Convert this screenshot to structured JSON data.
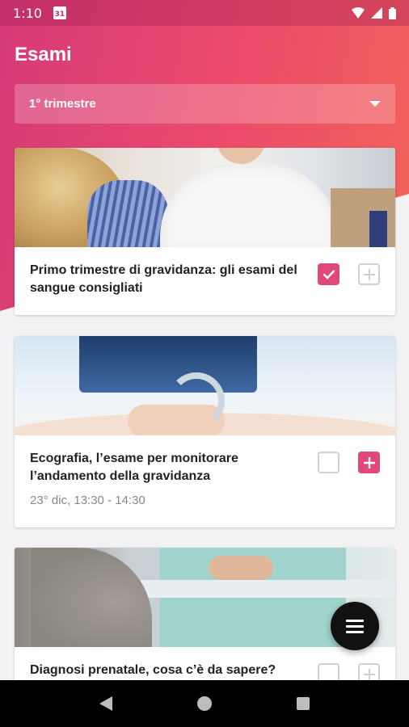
{
  "status_bar": {
    "time": "1:10",
    "calendar_day": "31"
  },
  "header": {
    "title": "Esami"
  },
  "trimester_select": {
    "selected": "1° trimestre"
  },
  "cards": [
    {
      "title": "Primo trimestre di gravidanza: gli esami del sangue consigliati",
      "date": "",
      "checked": true,
      "added": false
    },
    {
      "title": "Ecografia, l’esame per monitorare l’andamento della gravidanza",
      "date": "23° dic, 13:30 - 14:30",
      "checked": false,
      "added": true
    },
    {
      "title": "Diagnosi prenatale, cosa c’è da sapere?",
      "date": "",
      "checked": false,
      "added": false
    }
  ],
  "colors": {
    "accent": "#e0477a",
    "header_gradient_start": "#d63a78",
    "header_gradient_end": "#f2635a"
  },
  "icons": {
    "fab": "menu-icon",
    "checkbox_checked": "check-icon",
    "add": "plus-icon"
  }
}
